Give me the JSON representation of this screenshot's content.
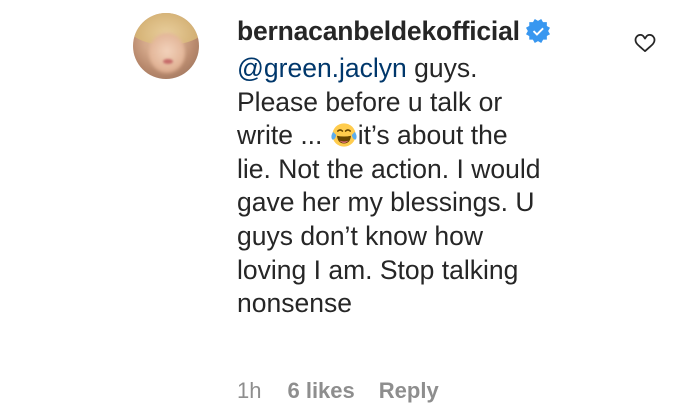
{
  "comment": {
    "avatar_icon": "profile-photo",
    "username": "bernacanbeldekofficial",
    "verified_icon": "verified-badge-icon",
    "verified_color": "#3897f0",
    "mention": "@green.jaclyn",
    "text_lines": [
      " guys.",
      "Please before u talk or",
      "write ... ",
      "it’s about the",
      "lie. Not the action. I would",
      "gave her my blessings. U",
      "guys don’t know how",
      "loving I am. Stop talking",
      "nonsense"
    ],
    "emoji_icon": "face-with-tears-of-joy-icon",
    "like_icon": "heart-outline-icon",
    "time": "1h",
    "likes": "6 likes",
    "reply_label": "Reply"
  },
  "colors": {
    "text": "#262626",
    "mention": "#00376b",
    "meta": "#8e8e8e",
    "background": "#ffffff"
  }
}
